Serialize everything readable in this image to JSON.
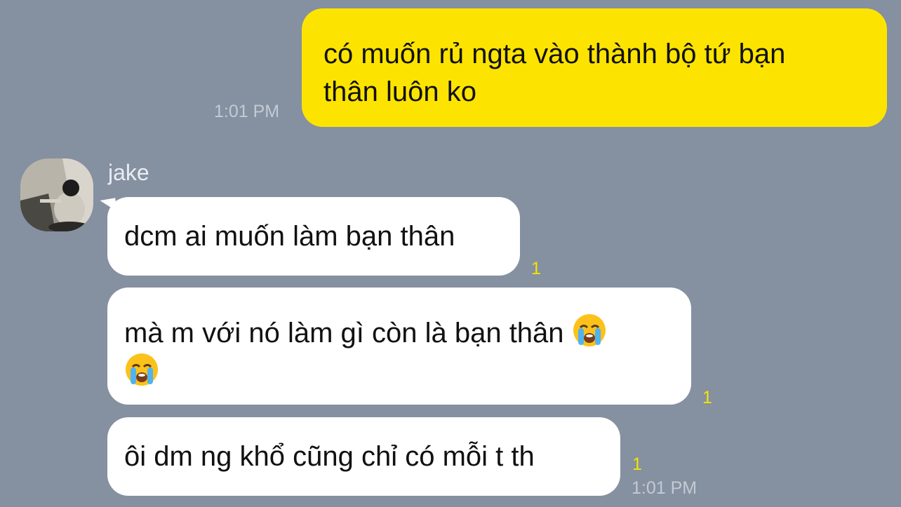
{
  "messages": {
    "outgoing": {
      "line1": "có muốn rủ ngta vào thành bộ tứ bạn",
      "line2": "thân luôn ko",
      "time": "1:01 PM"
    },
    "incoming": {
      "sender": "jake",
      "msg1": {
        "text": "dcm ai muốn làm bạn thân",
        "unread": "1"
      },
      "msg2": {
        "text": "mà m với nó làm gì còn là bạn thân",
        "unread": "1",
        "emoji": "loudly-crying-face"
      },
      "msg3": {
        "text": "ôi dm ng khổ cũng chỉ có mỗi t th",
        "unread": "1",
        "time": "1:01 PM"
      }
    }
  },
  "colors": {
    "background": "#8590a1",
    "outgoing_bubble": "#fde400",
    "incoming_bubble": "#ffffff",
    "unread": "#f5e300"
  }
}
